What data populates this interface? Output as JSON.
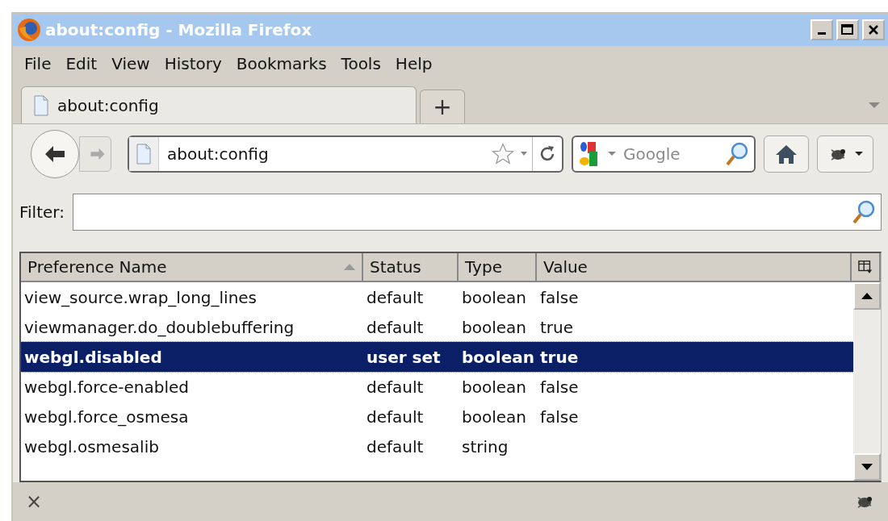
{
  "window": {
    "title": "about:config - Mozilla Firefox"
  },
  "menu": [
    "File",
    "Edit",
    "View",
    "History",
    "Bookmarks",
    "Tools",
    "Help"
  ],
  "tabs": [
    {
      "label": "about:config",
      "selected": true
    }
  ],
  "new_tab": "+",
  "address_bar": {
    "value": "about:config"
  },
  "search_bar": {
    "placeholder": "Google"
  },
  "filter": {
    "label": "Filter:"
  },
  "table": {
    "columns": [
      "Preference Name",
      "Status",
      "Type",
      "Value"
    ],
    "rows": [
      {
        "name": "view_source.wrap_long_lines",
        "status": "default",
        "type": "boolean",
        "value": "false",
        "modified": false,
        "selected": false
      },
      {
        "name": "viewmanager.do_doublebuffering",
        "status": "default",
        "type": "boolean",
        "value": "true",
        "modified": false,
        "selected": false
      },
      {
        "name": "webgl.disabled",
        "status": "user set",
        "type": "boolean",
        "value": "true",
        "modified": true,
        "selected": true
      },
      {
        "name": "webgl.force-enabled",
        "status": "default",
        "type": "boolean",
        "value": "false",
        "modified": false,
        "selected": false
      },
      {
        "name": "webgl.force_osmesa",
        "status": "default",
        "type": "boolean",
        "value": "false",
        "modified": false,
        "selected": false
      },
      {
        "name": "webgl.osmesalib",
        "status": "default",
        "type": "string",
        "modified": false,
        "selected": false
      }
    ]
  },
  "status_bar": {
    "close": "×"
  }
}
